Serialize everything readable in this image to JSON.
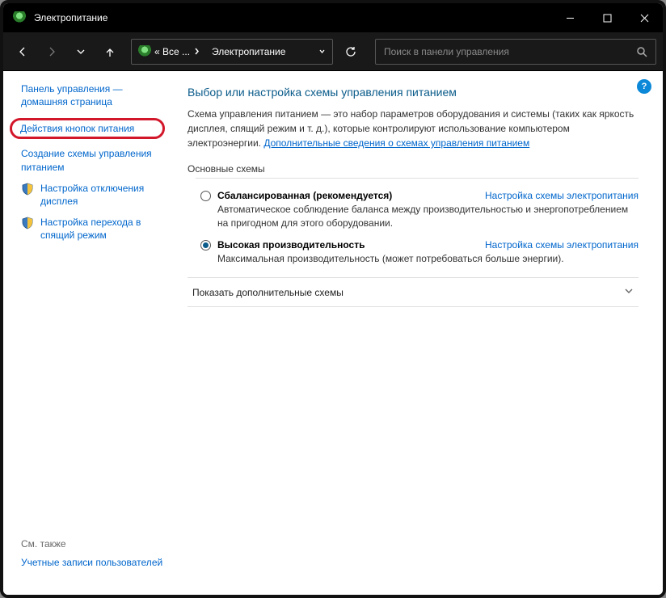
{
  "window": {
    "title": "Электропитание"
  },
  "nav": {
    "breadcrumb": {
      "root": "« Все ...",
      "current": "Электропитание"
    },
    "search_placeholder": "Поиск в панели управления"
  },
  "help": {
    "symbol": "?"
  },
  "sidebar": {
    "home": "Панель управления — домашняя страница",
    "highlighted": "Действия кнопок питания",
    "items": [
      {
        "label": "Создание схемы управления питанием"
      },
      {
        "label": "Настройка отключения дисплея"
      },
      {
        "label": "Настройка перехода в спящий режим"
      }
    ],
    "see_also_label": "См. также",
    "see_also_link": "Учетные записи пользователей"
  },
  "main": {
    "heading": "Выбор или настройка схемы управления питанием",
    "intro": "Схема управления питанием — это набор параметров оборудования и системы (таких как яркость дисплея, спящий режим и т. д.), которые контролируют использование компьютером электроэнергии. ",
    "intro_link": "Дополнительные сведения о схемах управления питанием",
    "group_label": "Основные схемы",
    "plan_link_label": "Настройка схемы электропитания",
    "plans": [
      {
        "name": "Сбалансированная (рекомендуется)",
        "desc": "Автоматическое соблюдение баланса между производительностью и энергопотреблением на пригодном для этого оборудовании.",
        "selected": false
      },
      {
        "name": "Высокая производительность",
        "desc": "Максимальная производительность (может потребоваться больше энергии).",
        "selected": true
      }
    ],
    "expand": "Показать дополнительные схемы"
  }
}
